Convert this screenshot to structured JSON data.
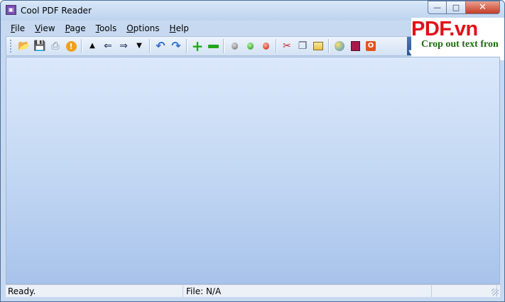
{
  "window": {
    "title": "Cool PDF Reader",
    "icon": "app-icon",
    "controls": [
      "minimize-icon",
      "maximize-icon",
      "close-icon"
    ]
  },
  "menu": {
    "items": [
      {
        "label": "File",
        "accel": "F",
        "rest": "ile"
      },
      {
        "label": "View",
        "accel": "V",
        "rest": "iew"
      },
      {
        "label": "Page",
        "accel": "P",
        "rest": "age"
      },
      {
        "label": "Tools",
        "accel": "T",
        "rest": "ools"
      },
      {
        "label": "Options",
        "accel": "O",
        "rest": "ptions"
      },
      {
        "label": "Help",
        "accel": "H",
        "rest": "elp"
      }
    ]
  },
  "toolbar": {
    "buttons": [
      "open-folder-icon",
      "save-icon",
      "print-icon",
      "info-icon",
      "page-up-icon",
      "back-icon",
      "forward-icon",
      "page-down-icon",
      "rotate-left-icon",
      "rotate-right-icon",
      "zoom-in-icon",
      "zoom-out-icon",
      "gray-dot-icon",
      "green-dot-icon",
      "red-dot-icon",
      "scissors-icon",
      "copy-icon",
      "image-icon",
      "globe-icon",
      "book-icon",
      "office-icon"
    ]
  },
  "brand": {
    "logo": "PDF.vn",
    "tagline": "Crop out text fron",
    "logo_color": "#e0101a",
    "tagline_color": "#1c6a10"
  },
  "status": {
    "left": "Ready.",
    "file": "File: N/A",
    "right": ""
  }
}
